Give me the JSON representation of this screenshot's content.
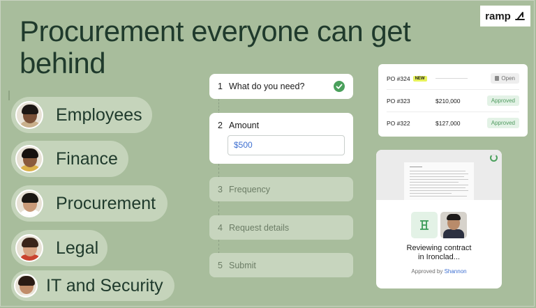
{
  "brand": {
    "name": "ramp"
  },
  "headline": "Procurement everyone can get behind",
  "roles": [
    {
      "label": "Employees",
      "skin": "#7a5138",
      "hair": "#1c1714",
      "shirt": "#c9b08c"
    },
    {
      "label": "Finance",
      "skin": "#8a5a3c",
      "hair": "#17110e",
      "shirt": "#dcb14a"
    },
    {
      "label": "Procurement",
      "skin": "#c99a78",
      "hair": "#1a1612",
      "shirt": "#ffffff"
    },
    {
      "label": "Legal",
      "skin": "#d7a382",
      "hair": "#3a2419",
      "shirt": "#c9432f"
    },
    {
      "label": "IT and Security",
      "skin": "#c08c69",
      "hair": "#2a1b14",
      "shirt": "#f1ede6"
    }
  ],
  "request_steps": [
    {
      "num": "1",
      "label": "What do you need?",
      "state": "done"
    },
    {
      "num": "2",
      "label": "Amount",
      "state": "active"
    },
    {
      "num": "3",
      "label": "Frequency",
      "state": "inactive"
    },
    {
      "num": "4",
      "label": "Request details",
      "state": "inactive"
    },
    {
      "num": "5",
      "label": "Submit",
      "state": "inactive"
    }
  ],
  "amount_input": {
    "value": "$500"
  },
  "purchase_orders": [
    {
      "id": "PO #324",
      "badge": "NEW",
      "amount": "",
      "status": "Open"
    },
    {
      "id": "PO #323",
      "badge": "",
      "amount": "$210,000",
      "status": "Approved"
    },
    {
      "id": "PO #322",
      "badge": "",
      "amount": "$127,000",
      "status": "Approved"
    }
  ],
  "contract": {
    "status": "Reviewing contract in Ironclad...",
    "approved_prefix": "Approved by",
    "approver": "Shannon"
  },
  "colors": {
    "background": "#a8bd9c",
    "pill": "#c5d4bb",
    "accent_green": "#4aa05c",
    "link_blue": "#3d6fd1"
  }
}
